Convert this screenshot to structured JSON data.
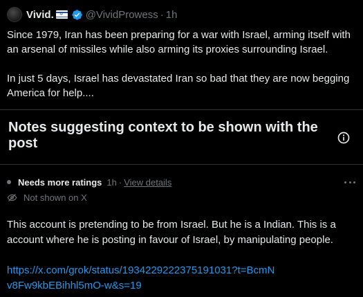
{
  "post": {
    "display_name": "Vivid.",
    "handle": "@VividProwess",
    "separator": "·",
    "time": "1h",
    "paragraphs": [
      "Since 1979, Iran has been preparing for a war with Israel, arming itself with an arsenal of missiles while also arming its proxies surrounding Israel.",
      "In just 5 days, Israel has devastated Iran so bad that they are now begging America for help...."
    ]
  },
  "notes": {
    "title": "Notes suggesting context to be shown with the post"
  },
  "note": {
    "status_label": "Needs more ratings",
    "time": "1h",
    "separator": "·",
    "view_details": "View details",
    "visibility": "Not shown on X",
    "text": "This account is pretending to be from Israel. But he is a Indian. This is a account where he is posting in favour of Israel, by manipulating people.",
    "link": "https://x.com/grok/status/1934229222375191031?t=BcmNv8Fw9kbEBihhl5mO-w&s=19"
  },
  "colors": {
    "background": "#000000",
    "text": "#e7e9ea",
    "muted": "#71767b",
    "link": "#1d9bf0",
    "verified": "#1d9bf0",
    "divider": "#2f3336"
  },
  "icons": {
    "verified": "verified-badge-icon",
    "flag": "israel-flag-emoji",
    "info": "info-circle-icon",
    "more": "more-horizontal-icon",
    "hidden": "eye-slash-icon"
  }
}
